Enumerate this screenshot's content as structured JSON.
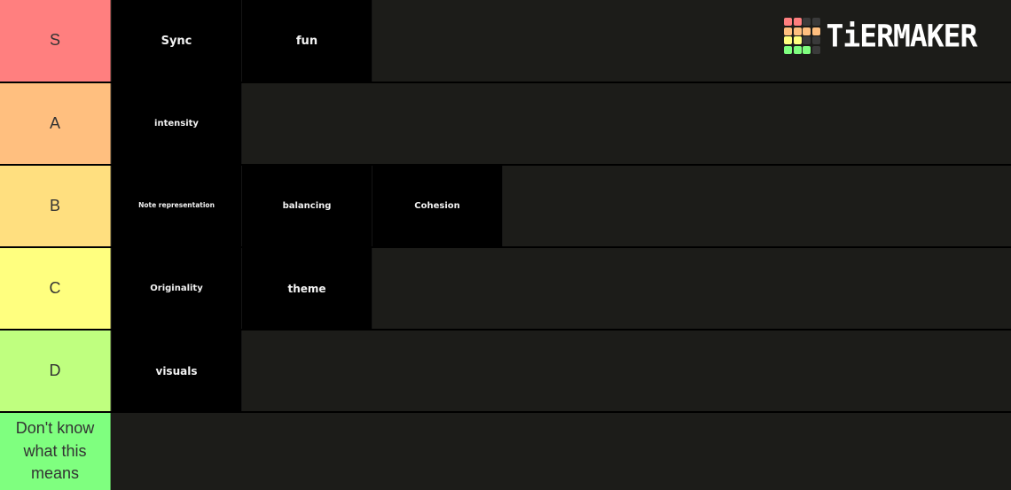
{
  "brand": {
    "name": "TiERMAKER",
    "grid_colors": [
      [
        "#ff7f7f",
        "#ff7f7f",
        "#3a3a3a",
        "#3a3a3a"
      ],
      [
        "#ffbf7f",
        "#ffbf7f",
        "#ffbf7f",
        "#ffbf7f"
      ],
      [
        "#ffff7f",
        "#ffff7f",
        "#3a3a3a",
        "#3a3a3a"
      ],
      [
        "#7fff7f",
        "#7fff7f",
        "#7fff7f",
        "#3a3a3a"
      ]
    ]
  },
  "tiers": [
    {
      "label": "S",
      "color": "#ff7f7f",
      "items": [
        "Sync",
        "fun"
      ]
    },
    {
      "label": "A",
      "color": "#ffbf7f",
      "items": [
        "intensity"
      ]
    },
    {
      "label": "B",
      "color": "#ffdf7f",
      "items": [
        "Note representation",
        "balancing",
        "Cohesion"
      ]
    },
    {
      "label": "C",
      "color": "#ffff7f",
      "items": [
        "Originality",
        "theme"
      ]
    },
    {
      "label": "D",
      "color": "#bfff7f",
      "items": [
        "visuals"
      ]
    },
    {
      "label": "Don't know what this means",
      "color": "#7fff7f",
      "items": []
    }
  ]
}
